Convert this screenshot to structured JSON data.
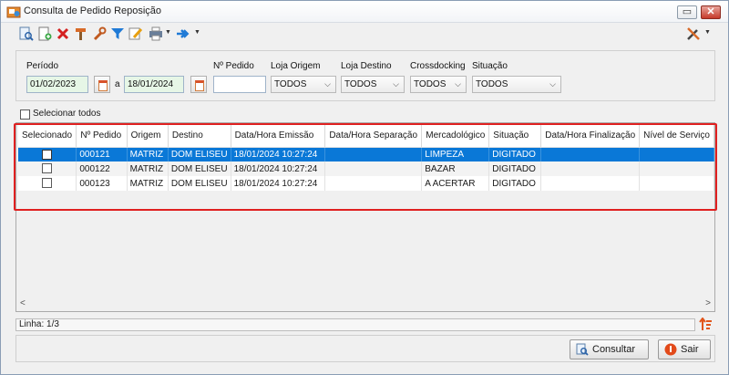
{
  "window": {
    "title": "Consulta de Pedido Reposição"
  },
  "toolbar": {
    "icons": [
      "search-document-icon",
      "new-document-icon",
      "delete-icon",
      "hammer-icon",
      "wrench-icon",
      "filter-icon",
      "edit-icon",
      "print-icon",
      "export-icon",
      "tools-icon"
    ]
  },
  "filters": {
    "periodo_label": "Período",
    "date_from": "01/02/2023",
    "date_sep": "a",
    "date_to": "18/01/2024",
    "pedido_label": "Nº Pedido",
    "pedido_value": "",
    "loja_origem_label": "Loja Origem",
    "loja_origem_value": "TODOS",
    "loja_destino_label": "Loja Destino",
    "loja_destino_value": "TODOS",
    "crossdocking_label": "Crossdocking",
    "crossdocking_value": "TODOS",
    "situacao_label": "Situação",
    "situacao_value": "TODOS"
  },
  "select_all": {
    "label": "Selecionar todos"
  },
  "grid": {
    "columns": [
      "Selecionado",
      "Nº Pedido",
      "Origem",
      "Destino",
      "Data/Hora Emissão",
      "Data/Hora Separação",
      "Mercadológico",
      "Situação",
      "Data/Hora Finalização",
      "Nível de Serviço"
    ],
    "rows": [
      [
        "",
        "000121",
        "MATRIZ",
        "DOM ELISEU",
        "18/01/2024 10:27:24",
        "",
        "LIMPEZA",
        "DIGITADO",
        "",
        ""
      ],
      [
        "",
        "000122",
        "MATRIZ",
        "DOM ELISEU",
        "18/01/2024 10:27:24",
        "",
        "BAZAR",
        "DIGITADO",
        "",
        ""
      ],
      [
        "",
        "000123",
        "MATRIZ",
        "DOM ELISEU",
        "18/01/2024 10:27:24",
        "",
        "A ACERTAR",
        "DIGITADO",
        "",
        ""
      ]
    ],
    "selected_row": 0
  },
  "status": {
    "text": "Linha: 1/3"
  },
  "footer": {
    "consultar_label": "Consultar",
    "sair_label": "Sair"
  },
  "colors": {
    "selection": "#0a78d7",
    "highlight_border": "#e02020",
    "accent": "#1a6fc9"
  }
}
